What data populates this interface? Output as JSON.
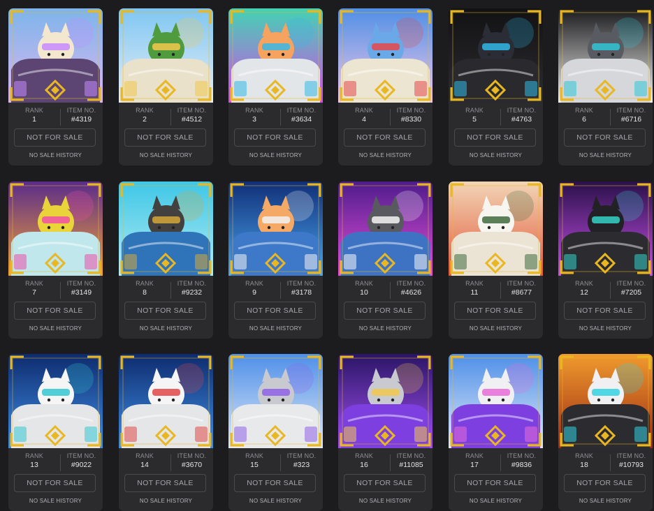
{
  "labels": {
    "rank": "RANK",
    "item_no": "ITEM NO.",
    "button": "NOT FOR SALE",
    "history": "NO SALE HISTORY"
  },
  "colors": {
    "page_bg": "#1c1c1e",
    "card_bg": "#2b2b2d",
    "frame_gold": "#e8b721",
    "pod_body": "#dcdde3"
  },
  "cards": [
    {
      "rank": "1",
      "item": "#4319",
      "bg": [
        "#7db5ea",
        "#d9b6f0"
      ],
      "pod": "#5c4572",
      "creature": "#f3e7cf",
      "accent": "#c58aff"
    },
    {
      "rank": "2",
      "item": "#4512",
      "bg": [
        "#7fc6f2",
        "#e6eef6"
      ],
      "pod": "#e9e1c9",
      "creature": "#4f9b3e",
      "accent": "#f2c94c"
    },
    {
      "rank": "3",
      "item": "#3634",
      "bg": [
        "#42d3b3",
        "#d64ae8"
      ],
      "pod": "#e3e6e8",
      "creature": "#f5a35f",
      "accent": "#37b8e6"
    },
    {
      "rank": "4",
      "item": "#8330",
      "bg": [
        "#4f8fe6",
        "#f0c7e8"
      ],
      "pod": "#ece5d2",
      "creature": "#6aa8e8",
      "accent": "#e54848"
    },
    {
      "rank": "5",
      "item": "#4763",
      "bg": [
        "#121214",
        "#2c2c30"
      ],
      "pod": "#2a2a2e",
      "creature": "#2b2d36",
      "accent": "#30b8e6"
    },
    {
      "rank": "6",
      "item": "#6716",
      "bg": [
        "#1a1a1c",
        "#f2f2f2"
      ],
      "pod": "#d5d7da",
      "creature": "#585b61",
      "accent": "#30c7d6"
    },
    {
      "rank": "7",
      "item": "#3149",
      "bg": [
        "#5a2c8a",
        "#f4a236"
      ],
      "pod": "#bfe7ec",
      "creature": "#e9d43a",
      "accent": "#f04fa7"
    },
    {
      "rank": "8",
      "item": "#9232",
      "bg": [
        "#3ec7e6",
        "#b1eaf4"
      ],
      "pod": "#2f73b8",
      "creature": "#434040",
      "accent": "#d4a73a"
    },
    {
      "rank": "9",
      "item": "#3178",
      "bg": [
        "#102f78",
        "#4aa5ec"
      ],
      "pod": "#3e79c9",
      "creature": "#f4a966",
      "accent": "#f2f2f2"
    },
    {
      "rank": "10",
      "item": "#4626",
      "bg": [
        "#4e1c8c",
        "#e44fd8"
      ],
      "pod": "#3e73c4",
      "creature": "#585a5f",
      "accent": "#f5f5f5"
    },
    {
      "rank": "11",
      "item": "#8677",
      "bg": [
        "#f2d5b6",
        "#e25a3a"
      ],
      "pod": "#ebe4d4",
      "creature": "#f7f5f0",
      "accent": "#3e6a3e"
    },
    {
      "rank": "12",
      "item": "#7205",
      "bg": [
        "#2a104a",
        "#c64fe8"
      ],
      "pod": "#2c2c30",
      "creature": "#222226",
      "accent": "#35d1c7"
    },
    {
      "rank": "13",
      "item": "#9022",
      "bg": [
        "#0e2b6e",
        "#3f8fe6"
      ],
      "pod": "#e5e6e8",
      "creature": "#f5f5f5",
      "accent": "#35c7d1"
    },
    {
      "rank": "14",
      "item": "#3670",
      "bg": [
        "#0e2b6e",
        "#3f8fe6"
      ],
      "pod": "#e5e6e8",
      "creature": "#f5f5f5",
      "accent": "#e24848"
    },
    {
      "rank": "15",
      "item": "#323",
      "bg": [
        "#4e8fe8",
        "#dfe9f7"
      ],
      "pod": "#e8e9eb",
      "creature": "#c8cacf",
      "accent": "#8f63e8"
    },
    {
      "rank": "16",
      "item": "#11085",
      "bg": [
        "#2a1566",
        "#a34ff0"
      ],
      "pod": "#7d3fe0",
      "creature": "#c8cacf",
      "accent": "#f2c94c"
    },
    {
      "rank": "17",
      "item": "#9836",
      "bg": [
        "#4e8fe8",
        "#dfe9f7"
      ],
      "pod": "#7d3fe0",
      "creature": "#f0f0f2",
      "accent": "#e86cd8"
    },
    {
      "rank": "18",
      "item": "#10793",
      "bg": [
        "#f09b2e",
        "#9c2a12"
      ],
      "pod": "#2c2c30",
      "creature": "#f0f0f2",
      "accent": "#35d1e0"
    }
  ]
}
